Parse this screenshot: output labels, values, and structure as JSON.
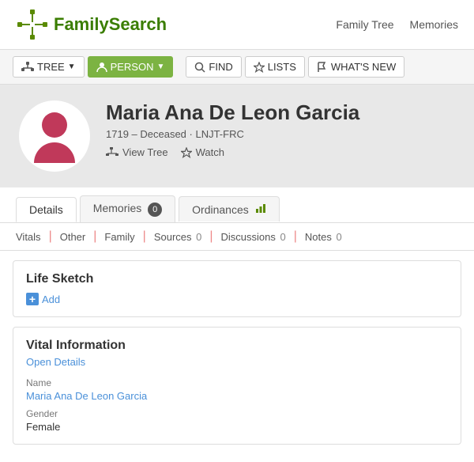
{
  "header": {
    "logo_text": "FamilySearch",
    "nav": [
      {
        "label": "Family Tree",
        "id": "family-tree"
      },
      {
        "label": "Memories",
        "id": "memories"
      }
    ]
  },
  "toolbar": {
    "tree_label": "TREE",
    "person_label": "PERSON",
    "find_label": "FIND",
    "lists_label": "LISTS",
    "whats_new_label": "WHAT'S NEW"
  },
  "profile": {
    "name": "Maria Ana De Leon Garcia",
    "meta": "1719 – Deceased · LNJT-FRC",
    "view_tree_label": "View Tree",
    "watch_label": "Watch"
  },
  "tabs": {
    "details_label": "Details",
    "memories_label": "Memories",
    "memories_count": "0",
    "ordinances_label": "Ordinances"
  },
  "sub_tabs": [
    {
      "label": "Vitals",
      "count": null
    },
    {
      "label": "Other",
      "count": null
    },
    {
      "label": "Family",
      "count": null
    },
    {
      "label": "Sources",
      "count": "0"
    },
    {
      "label": "Discussions",
      "count": "0"
    },
    {
      "label": "Notes",
      "count": "0"
    }
  ],
  "life_sketch": {
    "title": "Life Sketch",
    "add_label": "Add"
  },
  "vital_info": {
    "title": "Vital Information",
    "open_details_label": "Open Details",
    "name_label": "Name",
    "name_value": "Maria Ana De Leon Garcia",
    "gender_label": "Gender",
    "gender_value": "Female"
  }
}
